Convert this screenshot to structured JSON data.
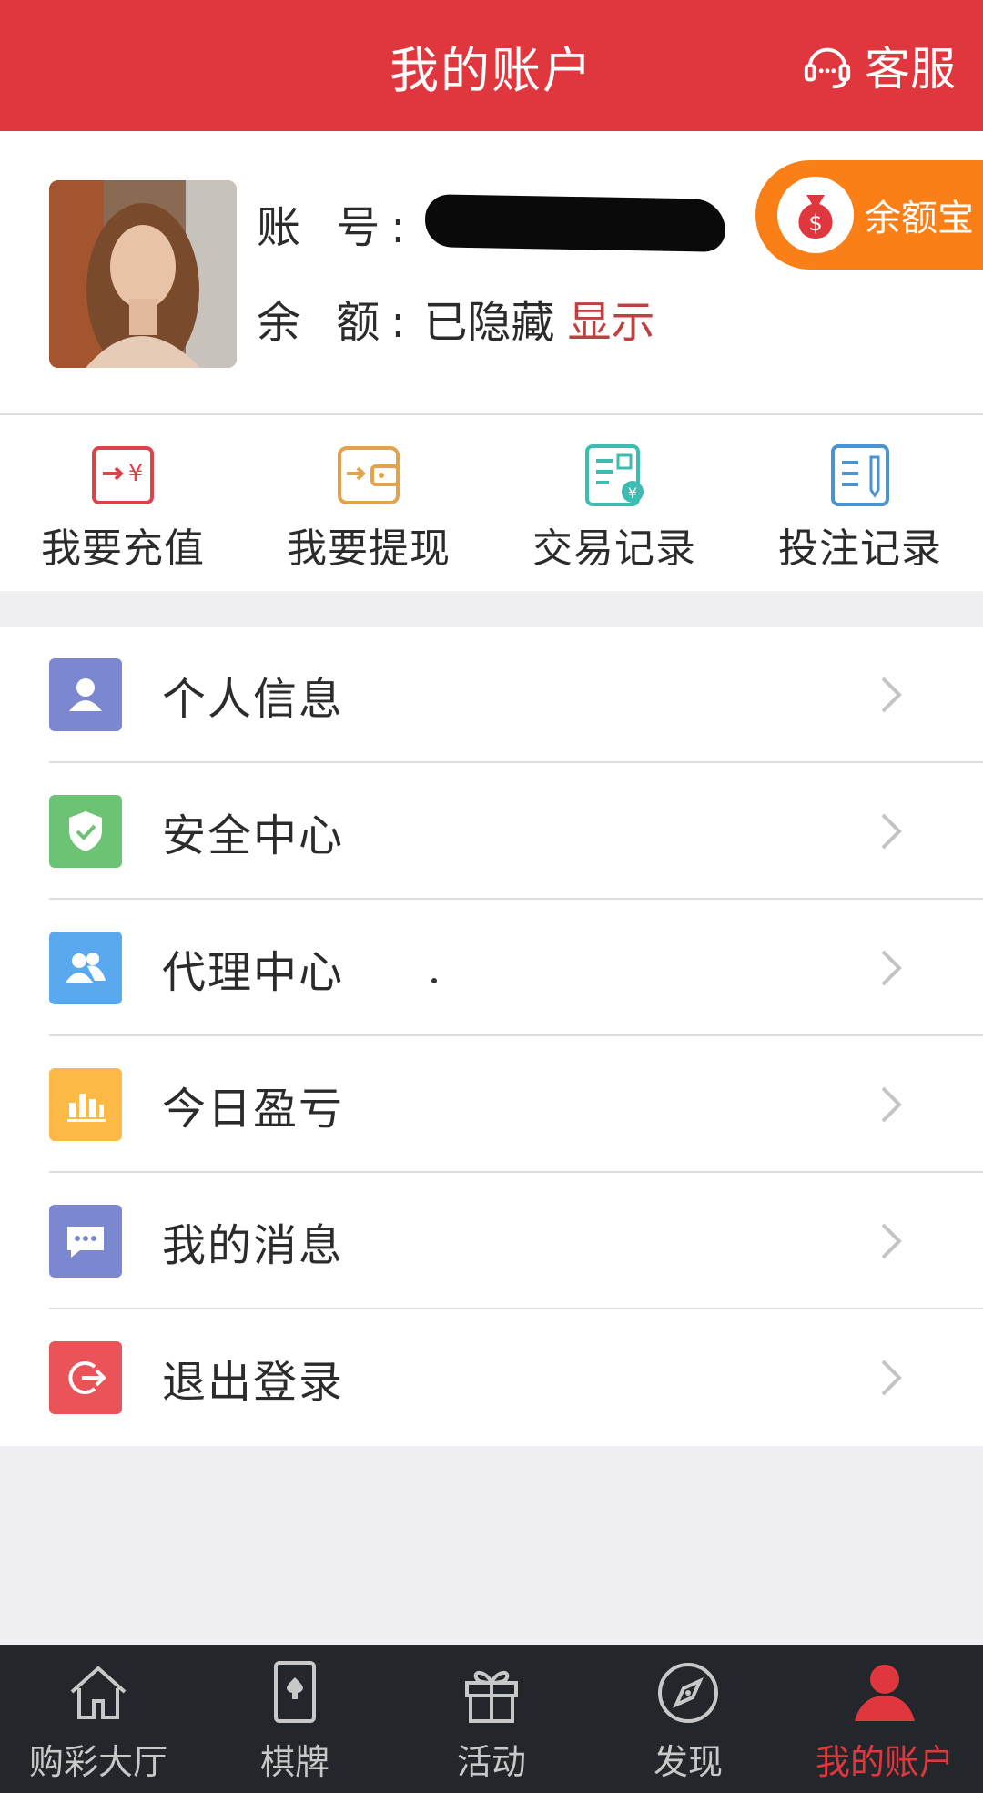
{
  "header": {
    "title": "我的账户",
    "service_label": "客服"
  },
  "profile": {
    "account_label": "账 号:",
    "balance_label": "余 额:",
    "balance_value": "已隐藏",
    "show_label": "显示",
    "yuebao_label": "余额宝"
  },
  "actions": [
    {
      "label": "我要充值",
      "icon": "recharge-icon",
      "color": "#d9434a"
    },
    {
      "label": "我要提现",
      "icon": "withdraw-icon",
      "color": "#e3a34c"
    },
    {
      "label": "交易记录",
      "icon": "transaction-record-icon",
      "color": "#3dbdb1"
    },
    {
      "label": "投注记录",
      "icon": "bet-record-icon",
      "color": "#4a93cf"
    }
  ],
  "menu": [
    {
      "label": "个人信息",
      "icon": "user-icon",
      "color": "#7b87cf"
    },
    {
      "label": "安全中心",
      "icon": "shield-icon",
      "color": "#6cc374"
    },
    {
      "label": "代理中心",
      "icon": "group-icon",
      "color": "#5aa8ee"
    },
    {
      "label": "今日盈亏",
      "icon": "bar-chart-icon",
      "color": "#fdb945"
    },
    {
      "label": "我的消息",
      "icon": "message-icon",
      "color": "#7b87cf"
    },
    {
      "label": "退出登录",
      "icon": "logout-icon",
      "color": "#ea5358"
    }
  ],
  "tabs": [
    {
      "label": "购彩大厅",
      "icon": "home-icon",
      "active": false
    },
    {
      "label": "棋牌",
      "icon": "card-icon",
      "active": false
    },
    {
      "label": "活动",
      "icon": "gift-icon",
      "active": false
    },
    {
      "label": "发现",
      "icon": "compass-icon",
      "active": false
    },
    {
      "label": "我的账户",
      "icon": "person-icon",
      "active": true
    }
  ],
  "colors": {
    "brand_red": "#e0363e",
    "orange": "#f97f16",
    "tabbar_bg": "#23262b"
  }
}
